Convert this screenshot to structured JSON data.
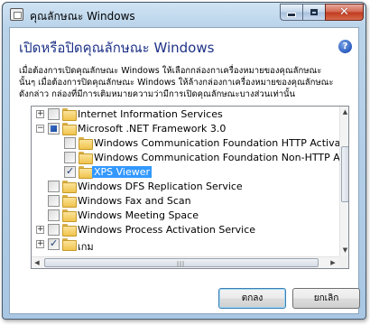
{
  "window": {
    "title": "คุณลักษณะ Windows"
  },
  "heading": "เปิดหรือปิดคุณลักษณะ Windows",
  "description_lines": [
    "เมื่อต้องการเปิดคุณลักษณะ Windows ให้เลือกกล่องกาเครื่องหมายของคุณลักษณะ",
    "นั้นๆ เมื่อต้องการปิดคุณลักษณะ Windows ให้ล้างกล่องกาเครื่องหมายของคุณลักษณะ",
    "ดังกล่าว กล่องที่มีการเติมหมายความว่ามีการเปิดคุณลักษณะบางส่วนเท่านั้น"
  ],
  "features": [
    {
      "label": "Internet Information Services",
      "expander": "+",
      "state": "unchecked"
    },
    {
      "label": "Microsoft .NET Framework 3.0",
      "expander": "−",
      "state": "partial"
    },
    {
      "label": "Windows Communication Foundation HTTP Activation",
      "expander": "",
      "state": "unchecked"
    },
    {
      "label": "Windows Communication Foundation Non-HTTP Activa",
      "expander": "",
      "state": "unchecked"
    },
    {
      "label": "XPS Viewer",
      "expander": "",
      "state": "checked",
      "selected": true
    },
    {
      "label": "Windows DFS Replication Service",
      "expander": "",
      "state": "unchecked"
    },
    {
      "label": "Windows Fax and Scan",
      "expander": "",
      "state": "unchecked"
    },
    {
      "label": "Windows Meeting Space",
      "expander": "",
      "state": "unchecked"
    },
    {
      "label": "Windows Process Activation Service",
      "expander": "+",
      "state": "unchecked"
    },
    {
      "label": "เกม",
      "expander": "+",
      "state": "checked"
    }
  ],
  "buttons": {
    "ok": "ตกลง",
    "cancel": "ยกเลิก"
  },
  "icons": {
    "help": "?",
    "close": "✕",
    "scroll_up": "▲",
    "scroll_down": "▼",
    "scroll_left": "◀",
    "scroll_right": "▶",
    "grip": "|||"
  },
  "colors": {
    "heading": "#1e3287",
    "selection": "#3399ff"
  }
}
